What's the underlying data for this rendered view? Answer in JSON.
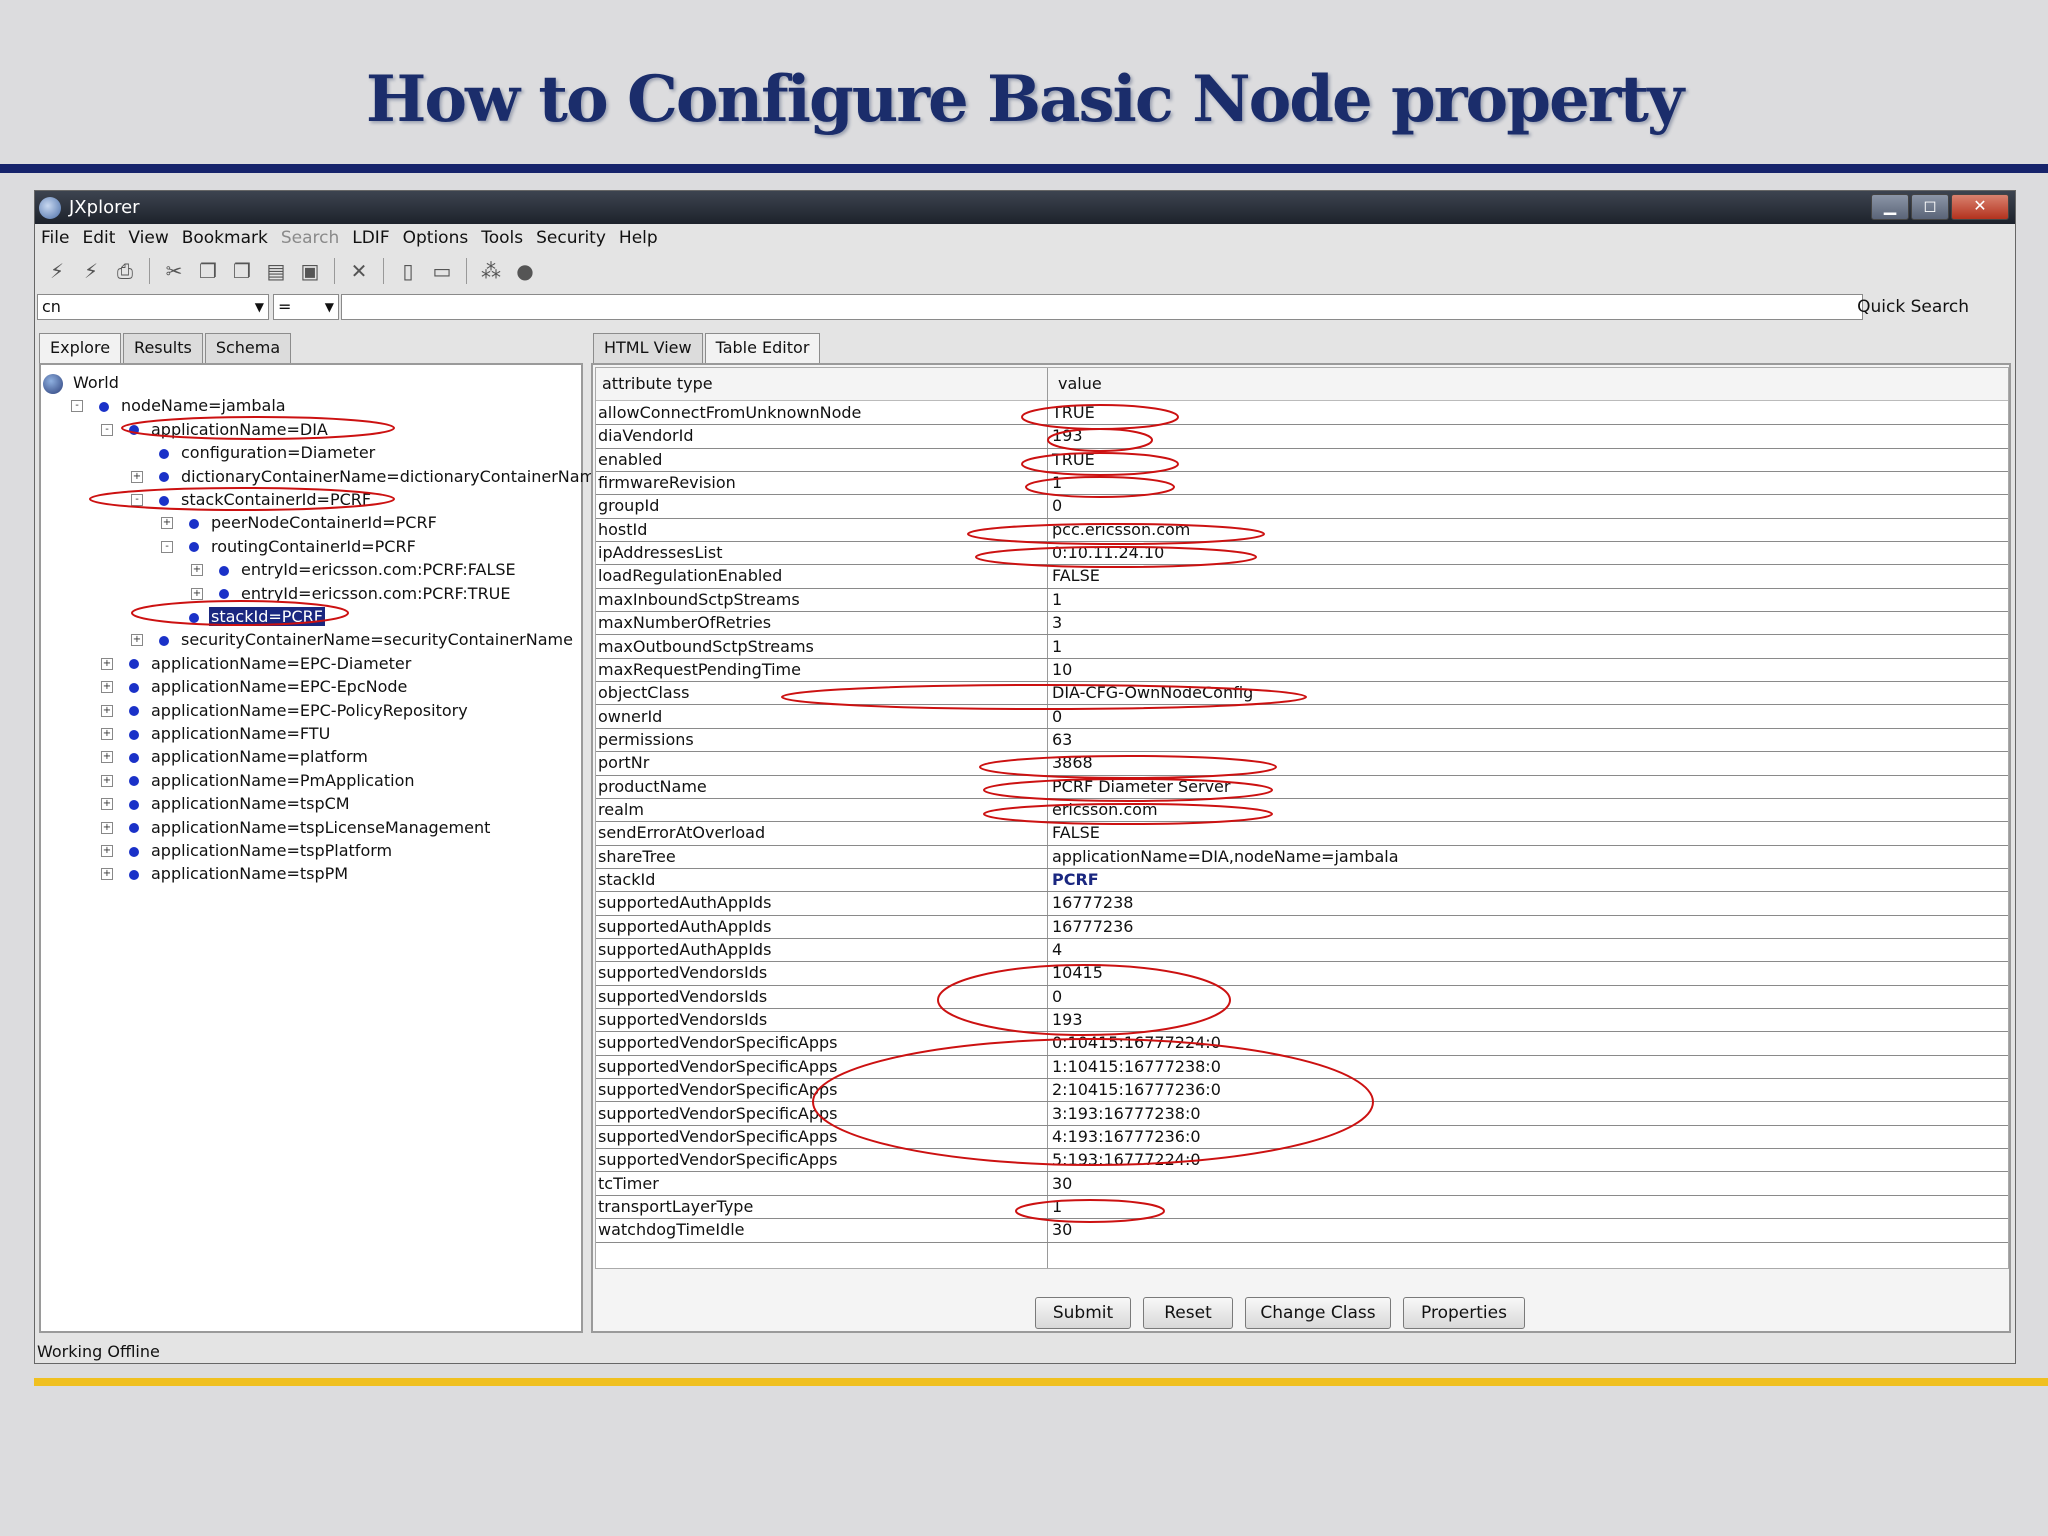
{
  "slide": {
    "title": "How to Configure Basic Node property"
  },
  "window": {
    "title": "JXplorer",
    "controls": [
      "▁",
      "◻",
      "✕"
    ]
  },
  "menu": [
    "File",
    "Edit",
    "View",
    "Bookmark",
    "Search",
    "LDIF",
    "Options",
    "Tools",
    "Security",
    "Help"
  ],
  "menu_disabled": [
    "Search"
  ],
  "toolbar_icons": [
    "connect-icon",
    "disconnect-icon",
    "print-icon",
    "cut-icon",
    "copy-icon",
    "copy-dn-icon",
    "paste-icon",
    "paste-alias-icon",
    "delete-icon",
    "new-entry-icon",
    "dn-icon",
    "refresh-icon",
    "stop-icon"
  ],
  "search": {
    "attribute": "cn",
    "operator": "=",
    "value": "",
    "quick_search_label": "Quick Search"
  },
  "left_tabs": [
    "Explore",
    "Results",
    "Schema"
  ],
  "tree": [
    {
      "label": "World",
      "depth": 0,
      "icon": "globe-icon",
      "expander": ""
    },
    {
      "label": "nodeName=jambala",
      "depth": 1,
      "expander": "-"
    },
    {
      "label": "applicationName=DIA",
      "depth": 2,
      "expander": "-",
      "highlighted": true
    },
    {
      "label": "configuration=Diameter",
      "depth": 3,
      "expander": ""
    },
    {
      "label": "dictionaryContainerName=dictionaryContainerName",
      "depth": 3,
      "expander": "+"
    },
    {
      "label": "stackContainerId=PCRF",
      "depth": 3,
      "expander": "-",
      "highlighted": true
    },
    {
      "label": "peerNodeContainerId=PCRF",
      "depth": 4,
      "expander": "+"
    },
    {
      "label": "routingContainerId=PCRF",
      "depth": 4,
      "expander": "-"
    },
    {
      "label": "entryId=ericsson.com:PCRF:FALSE",
      "depth": 5,
      "expander": "+"
    },
    {
      "label": "entryId=ericsson.com:PCRF:TRUE",
      "depth": 5,
      "expander": "+"
    },
    {
      "label": "stackId=PCRF",
      "depth": 4,
      "expander": "",
      "selected": true,
      "highlighted": true
    },
    {
      "label": "securityContainerName=securityContainerName",
      "depth": 3,
      "expander": "+"
    },
    {
      "label": "applicationName=EPC-Diameter",
      "depth": 2,
      "expander": "+"
    },
    {
      "label": "applicationName=EPC-EpcNode",
      "depth": 2,
      "expander": "+"
    },
    {
      "label": "applicationName=EPC-PolicyRepository",
      "depth": 2,
      "expander": "+"
    },
    {
      "label": "applicationName=FTU",
      "depth": 2,
      "expander": "+"
    },
    {
      "label": "applicationName=platform",
      "depth": 2,
      "expander": "+"
    },
    {
      "label": "applicationName=PmApplication",
      "depth": 2,
      "expander": "+"
    },
    {
      "label": "applicationName=tspCM",
      "depth": 2,
      "expander": "+"
    },
    {
      "label": "applicationName=tspLicenseManagement",
      "depth": 2,
      "expander": "+"
    },
    {
      "label": "applicationName=tspPlatform",
      "depth": 2,
      "expander": "+"
    },
    {
      "label": "applicationName=tspPM",
      "depth": 2,
      "expander": "+"
    }
  ],
  "right_tabs": [
    "HTML View",
    "Table Editor"
  ],
  "table": {
    "headers": [
      "attribute type",
      "value"
    ],
    "rows": [
      [
        "allowConnectFromUnknownNode",
        "TRUE"
      ],
      [
        "diaVendorId",
        "193"
      ],
      [
        "enabled",
        "TRUE"
      ],
      [
        "firmwareRevision",
        "1"
      ],
      [
        "groupId",
        "0"
      ],
      [
        "hostId",
        "pcc.ericsson.com"
      ],
      [
        "ipAddressesList",
        "0:10.11.24.10"
      ],
      [
        "loadRegulationEnabled",
        "FALSE"
      ],
      [
        "maxInboundSctpStreams",
        "1"
      ],
      [
        "maxNumberOfRetries",
        "3"
      ],
      [
        "maxOutboundSctpStreams",
        "1"
      ],
      [
        "maxRequestPendingTime",
        "10"
      ],
      [
        "objectClass",
        "DIA-CFG-OwnNodeConfig"
      ],
      [
        "ownerId",
        "0"
      ],
      [
        "permissions",
        "63"
      ],
      [
        "portNr",
        "3868"
      ],
      [
        "productName",
        "PCRF Diameter Server"
      ],
      [
        "realm",
        "ericsson.com"
      ],
      [
        "sendErrorAtOverload",
        "FALSE"
      ],
      [
        "shareTree",
        "applicationName=DIA,nodeName=jambala"
      ],
      [
        "stackId",
        "PCRF"
      ],
      [
        "supportedAuthAppIds",
        "16777238"
      ],
      [
        "supportedAuthAppIds",
        "16777236"
      ],
      [
        "supportedAuthAppIds",
        "4"
      ],
      [
        "supportedVendorsIds",
        "10415"
      ],
      [
        "supportedVendorsIds",
        "0"
      ],
      [
        "supportedVendorsIds",
        "193"
      ],
      [
        "supportedVendorSpecificApps",
        "0:10415:16777224:0"
      ],
      [
        "supportedVendorSpecificApps",
        "1:10415:16777238:0"
      ],
      [
        "supportedVendorSpecificApps",
        "2:10415:16777236:0"
      ],
      [
        "supportedVendorSpecificApps",
        "3:193:16777238:0"
      ],
      [
        "supportedVendorSpecificApps",
        "4:193:16777236:0"
      ],
      [
        "supportedVendorSpecificApps",
        "5:193:16777224:0"
      ],
      [
        "tcTimer",
        "30"
      ],
      [
        "transportLayerType",
        "1"
      ],
      [
        "watchdogTimeIdle",
        "30"
      ]
    ]
  },
  "buttons": [
    "Submit",
    "Reset",
    "Change Class",
    "Properties"
  ],
  "status": "Working Offline",
  "colors": {
    "title": "#1b2d6b",
    "accent_bar": "#16236b",
    "gold_bar": "#f0c020",
    "annotation": "#cc1111",
    "selection": "#1a2780"
  }
}
